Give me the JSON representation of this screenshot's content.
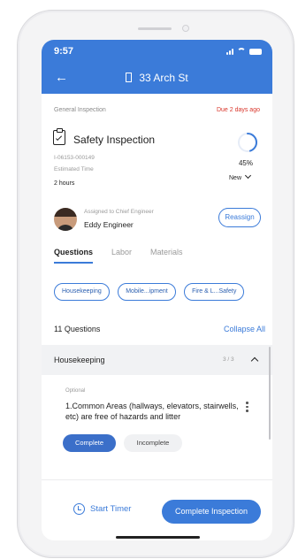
{
  "status_bar": {
    "time": "9:57"
  },
  "header": {
    "back_icon": "arrow-left-icon",
    "building_icon": "building-icon",
    "title": "33 Arch St"
  },
  "inspection": {
    "type": "General Inspection",
    "due": "Due 2 days ago",
    "title": "Safety Inspection",
    "id": "I-06153-000149",
    "estimated_time_label": "Estimated Time",
    "estimated_time": "2 hours",
    "progress_percent": 45,
    "progress_label": "45%",
    "status": "New"
  },
  "assignee": {
    "label": "Assigned to Chief Engineer",
    "name": "Eddy Engineer",
    "reassign_label": "Reassign"
  },
  "tabs": [
    {
      "label": "Questions",
      "active": true
    },
    {
      "label": "Labor",
      "active": false
    },
    {
      "label": "Materials",
      "active": false
    }
  ],
  "chips": [
    "Housekeeping",
    "Mobile...ipment",
    "Fire & L...Safety"
  ],
  "questions_summary": {
    "count_label": "11 Questions",
    "collapse_label": "Collapse All"
  },
  "section": {
    "title": "Housekeeping",
    "count": "3 / 3"
  },
  "question": {
    "optional_label": "Optional",
    "text": "1.Common Areas (hallways, elevators, stairwells, etc) are free of hazards and litter",
    "complete_label": "Complete",
    "incomplete_label": "Incomplete"
  },
  "actions": {
    "start_timer_label": "Start Timer",
    "complete_label": "Complete Inspection"
  },
  "colors": {
    "accent": "#3b7bd9",
    "due": "#d9362b",
    "section_bg": "#f1f2f4"
  }
}
